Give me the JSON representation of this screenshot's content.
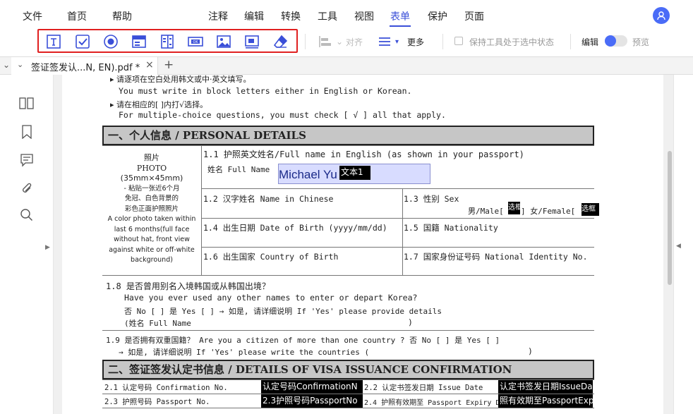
{
  "menubar": {
    "left_items": [
      "文件",
      "首页",
      "帮助"
    ],
    "center_items": [
      "注释",
      "编辑",
      "转换",
      "工具",
      "视图",
      "表单",
      "保护",
      "页面"
    ],
    "active_item": "表单"
  },
  "toolbar": {
    "form_tools": [
      "text-field",
      "checkbox",
      "radio-button",
      "combo-box",
      "list-box",
      "button",
      "image-field",
      "signature-field",
      "eraser"
    ],
    "align_label": "对齐",
    "more_label": "更多",
    "keep_tool_label": "保持工具处于选中状态",
    "edit_label": "编辑",
    "preview_label": "预览"
  },
  "tabs": {
    "current_tab": "签证签发认...N, EN).pdf *",
    "close_glyph": "×",
    "add_glyph": "+"
  },
  "document": {
    "instr1": "▸ 请逐项在空白处用韩文或中·英文填写。",
    "instr2": "You must write in block letters either in English or Korean.",
    "instr3": "▸ 请在相应的[  ]内打√选择。",
    "instr4": "For multiple-choice questions, you must check [ √ ] all that apply.",
    "section1": "一、个人信息 / PERSONAL DETAILS",
    "photo_lines": [
      "照片",
      "PHOTO",
      "(35mm×45mm)",
      "- 粘贴一张近6个月",
      "免冠、白色背景的",
      "彩色正面护照照片",
      "A color photo taken within",
      "last 6 months(full face",
      "without hat, front view",
      "against white or off-white",
      "background)"
    ],
    "f11_label": "1.1 护照英文姓名/Full name in English (as shown in your passport)",
    "f11_sub": "姓名 Full Name",
    "f11_value": "Michael Yu",
    "f11_tag": "文本1",
    "f12_label": "1.2 汉字姓名 Name in Chinese",
    "f13_label": "1.3 性别 Sex",
    "f13_male": "男/Male[",
    "f13_female": "]  女/Female[",
    "f13_tag": "选框",
    "f14_label": "1.4 出生日期 Date of Birth (yyyy/mm/dd)",
    "f15_label": "1.5 国籍 Nationality",
    "f16_label": "1.6 出生国家 Country of Birth",
    "f17_label": "1.7 国家身份证号码 National Identity No.",
    "f18_l1": "1.8 是否曾用别名入境韩国或从韩国出境？",
    "f18_l2": "Have you ever used any other names to enter or depart Korea?",
    "f18_l3": "否 No [   ]   是 Yes [   ]   → 如是, 请详细说明 If 'Yes' please provide details",
    "f18_l4": "(姓名 Full Name",
    "f18_l4_end": ")",
    "f19_l1": "1.9 是否拥有双重国籍？ Are you a citizen of more than one country ?   否 No [   ]   是 Yes [   ]",
    "f19_l2": "→ 如是, 请详细说明 If 'Yes' please write the countries  (",
    "f19_l2_end": ")",
    "section2": "二、签证签发认定书信息 / DETAILS OF VISA ISSUANCE CONFIRMATION",
    "f21_label": "2.1 认定号码 Confirmation No.",
    "f21_field": "认定号码ConfirmationN",
    "f22_label": "2.2 认定书签发日期 Issue Date",
    "f22_field": "认定书签发日期IssueDa",
    "f23_label": "2.3 护照号码 Passport No.",
    "f23_field": "2.3护照号码PassportNo",
    "f24_label": "2.4 护照有效期至 Passport Expiry Date",
    "f24_field": "照有效期至PassportExpi"
  }
}
